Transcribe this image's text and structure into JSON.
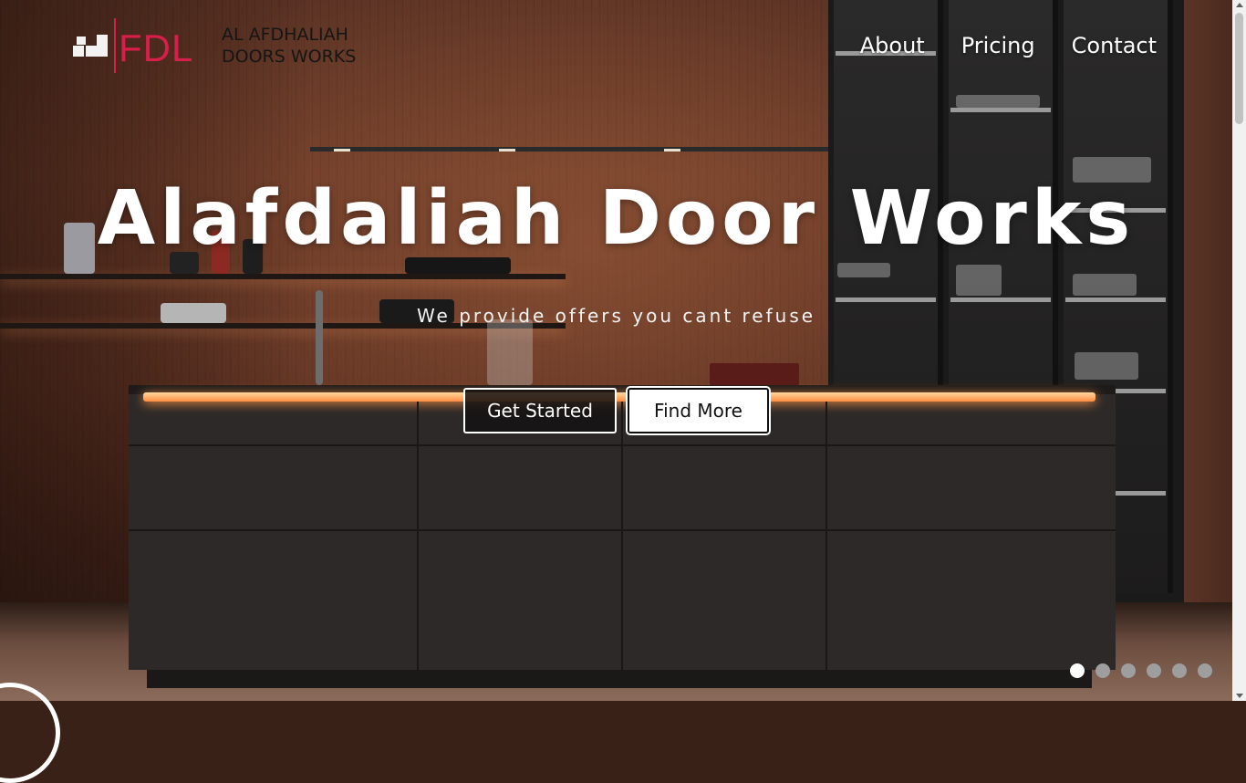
{
  "brand": {
    "logo_letters": "FDL",
    "company_name": "AL AFDHALIAH\nDOORS WORKS",
    "accent_color": "#d81e4a"
  },
  "nav": {
    "items": [
      {
        "label": "About"
      },
      {
        "label": "Pricing"
      },
      {
        "label": "Contact"
      }
    ]
  },
  "hero": {
    "title": "Alafdaliah Door Works",
    "subtitle": "We provide offers you cant refuse",
    "primary_button": "Get Started",
    "secondary_button": "Find More",
    "background_image": "kitchen-walnut-wall"
  },
  "carousel": {
    "slide_count": 6,
    "active_slide": 1
  },
  "icons": {
    "logo_mark": "stacked-boxes-icon",
    "corner": "circle-outline-icon"
  }
}
